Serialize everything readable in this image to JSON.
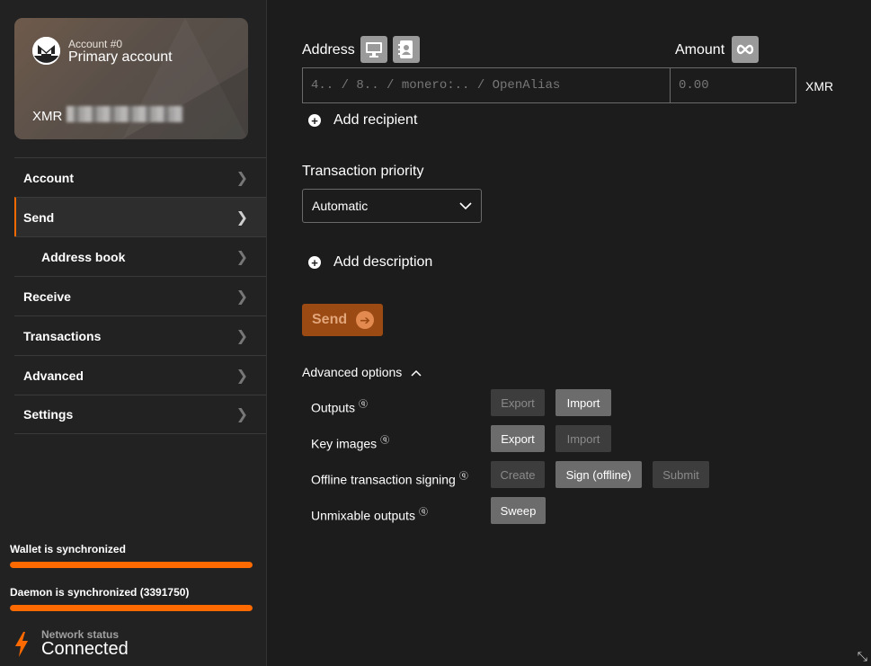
{
  "colors": {
    "accent": "#ff6a00",
    "send_button": "#9a4a12",
    "sidebar_bg": "#222222",
    "main_bg": "#1c1c1c"
  },
  "account_card": {
    "logo_icon": "monero-logo-icon",
    "subtitle": "Account #0",
    "title": "Primary account",
    "currency": "XMR"
  },
  "sidebar": {
    "items": [
      {
        "label": "Account",
        "icon": "chevron-right-icon"
      },
      {
        "label": "Send",
        "icon": "chevron-right-icon",
        "active": true
      },
      {
        "label": "Address book",
        "icon": "chevron-right-icon",
        "sub": true
      },
      {
        "label": "Receive",
        "icon": "chevron-right-icon"
      },
      {
        "label": "Transactions",
        "icon": "chevron-right-icon"
      },
      {
        "label": "Advanced",
        "icon": "chevron-right-icon"
      },
      {
        "label": "Settings",
        "icon": "chevron-right-icon"
      }
    ],
    "wallet_sync": {
      "label": "Wallet is synchronized",
      "progress": 1.0
    },
    "daemon_sync": {
      "label": "Daemon is synchronized (3391750)",
      "progress": 1.0
    },
    "network": {
      "label": "Network status",
      "value": "Connected",
      "icon": "lightning-bolt-icon"
    }
  },
  "send": {
    "address_label": "Address",
    "address_icons": [
      "monitor-icon",
      "address-book-icon"
    ],
    "amount_label": "Amount",
    "amount_icon": "infinity-icon",
    "address_placeholder": "4.. / 8.. / monero:.. / OpenAlias",
    "amount_placeholder": "0.00",
    "currency": "XMR",
    "add_recipient": "Add recipient",
    "priority_label": "Transaction priority",
    "priority_value": "Automatic",
    "add_description": "Add description",
    "send_label": "Send"
  },
  "advanced": {
    "title": "Advanced options",
    "rows": [
      {
        "label": "Outputs",
        "buttons": [
          {
            "label": "Export",
            "enabled": false
          },
          {
            "label": "Import",
            "enabled": true
          }
        ]
      },
      {
        "label": "Key images",
        "buttons": [
          {
            "label": "Export",
            "enabled": true
          },
          {
            "label": "Import",
            "enabled": false
          }
        ]
      },
      {
        "label": "Offline transaction signing",
        "buttons": [
          {
            "label": "Create",
            "enabled": false
          },
          {
            "label": "Sign (offline)",
            "enabled": true
          },
          {
            "label": "Submit",
            "enabled": false
          }
        ]
      },
      {
        "label": "Unmixable outputs",
        "buttons": [
          {
            "label": "Sweep",
            "enabled": true
          }
        ]
      }
    ]
  }
}
